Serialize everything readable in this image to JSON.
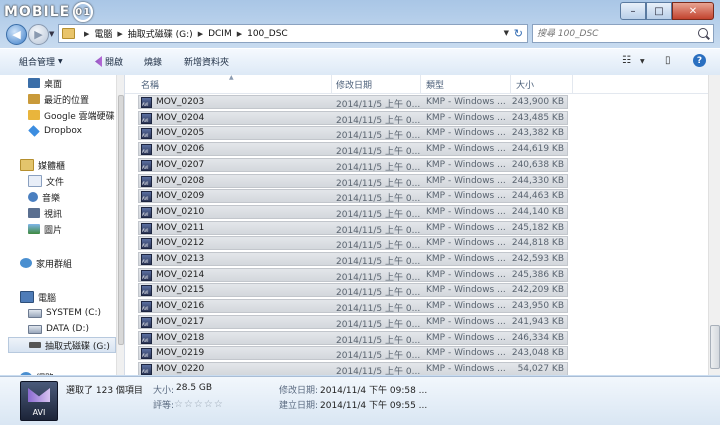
{
  "watermark": {
    "text": "MOBILE",
    "badge": "01"
  },
  "window_controls": {
    "minimize": "–",
    "maximize": "□",
    "close": "✕"
  },
  "nav_buttons": {
    "back": "◀",
    "forward": "▶",
    "dropdown": "▼"
  },
  "address": {
    "crumbs": [
      "電腦",
      "抽取式磁碟 (G:)",
      "DCIM",
      "100_DSC"
    ],
    "separator": "▶",
    "dropdown": "▼",
    "refresh": "↻"
  },
  "search": {
    "placeholder": "搜尋 100_DSC"
  },
  "toolbar": {
    "organize": "組合管理",
    "organize_arrow": "▼",
    "open": "開啟",
    "burn": "燒錄",
    "new_folder": "新增資料夾",
    "view_icon": "☷",
    "view_arrow": "▼",
    "pane_icon": "▯",
    "help": "?"
  },
  "sidebar": {
    "items": [
      {
        "label": "桌面",
        "icon": "desktop-icon"
      },
      {
        "label": "最近的位置",
        "icon": "recent-places-icon"
      },
      {
        "label": "Google 雲端硬碟",
        "icon": "google-drive-icon"
      },
      {
        "label": "Dropbox",
        "icon": "dropbox-icon"
      },
      {
        "label": "媒體櫃",
        "icon": "library-icon"
      },
      {
        "label": "文件",
        "icon": "documents-icon"
      },
      {
        "label": "音樂",
        "icon": "music-icon"
      },
      {
        "label": "視訊",
        "icon": "video-icon"
      },
      {
        "label": "圖片",
        "icon": "pictures-icon"
      },
      {
        "label": "家用群組",
        "icon": "homegroup-icon"
      },
      {
        "label": "電腦",
        "icon": "computer-icon"
      },
      {
        "label": "SYSTEM (C:)",
        "icon": "drive-icon"
      },
      {
        "label": "DATA (D:)",
        "icon": "drive-icon"
      },
      {
        "label": "抽取式磁碟 (G:)",
        "icon": "usb-drive-icon"
      },
      {
        "label": "網路",
        "icon": "network-icon"
      }
    ]
  },
  "columns": {
    "name": "名稱",
    "modified": "修改日期",
    "type": "類型",
    "size": "大小",
    "sort_arrow": "▲"
  },
  "files": [
    {
      "name": "MOV_0203",
      "modified": "2014/11/5 上午 0...",
      "type": "KMP - Windows ...",
      "size": "243,900 KB"
    },
    {
      "name": "MOV_0204",
      "modified": "2014/11/5 上午 0...",
      "type": "KMP - Windows ...",
      "size": "243,485 KB"
    },
    {
      "name": "MOV_0205",
      "modified": "2014/11/5 上午 0...",
      "type": "KMP - Windows ...",
      "size": "243,382 KB"
    },
    {
      "name": "MOV_0206",
      "modified": "2014/11/5 上午 0...",
      "type": "KMP - Windows ...",
      "size": "244,619 KB"
    },
    {
      "name": "MOV_0207",
      "modified": "2014/11/5 上午 0...",
      "type": "KMP - Windows ...",
      "size": "240,638 KB"
    },
    {
      "name": "MOV_0208",
      "modified": "2014/11/5 上午 0...",
      "type": "KMP - Windows ...",
      "size": "244,330 KB"
    },
    {
      "name": "MOV_0209",
      "modified": "2014/11/5 上午 0...",
      "type": "KMP - Windows ...",
      "size": "244,463 KB"
    },
    {
      "name": "MOV_0210",
      "modified": "2014/11/5 上午 0...",
      "type": "KMP - Windows ...",
      "size": "244,140 KB"
    },
    {
      "name": "MOV_0211",
      "modified": "2014/11/5 上午 0...",
      "type": "KMP - Windows ...",
      "size": "245,182 KB"
    },
    {
      "name": "MOV_0212",
      "modified": "2014/11/5 上午 0...",
      "type": "KMP - Windows ...",
      "size": "244,818 KB"
    },
    {
      "name": "MOV_0213",
      "modified": "2014/11/5 上午 0...",
      "type": "KMP - Windows ...",
      "size": "242,593 KB"
    },
    {
      "name": "MOV_0214",
      "modified": "2014/11/5 上午 0...",
      "type": "KMP - Windows ...",
      "size": "245,386 KB"
    },
    {
      "name": "MOV_0215",
      "modified": "2014/11/5 上午 0...",
      "type": "KMP - Windows ...",
      "size": "242,209 KB"
    },
    {
      "name": "MOV_0216",
      "modified": "2014/11/5 上午 0...",
      "type": "KMP - Windows ...",
      "size": "243,950 KB"
    },
    {
      "name": "MOV_0217",
      "modified": "2014/11/5 上午 0...",
      "type": "KMP - Windows ...",
      "size": "241,943 KB"
    },
    {
      "name": "MOV_0218",
      "modified": "2014/11/5 上午 0...",
      "type": "KMP - Windows ...",
      "size": "246,334 KB"
    },
    {
      "name": "MOV_0219",
      "modified": "2014/11/5 上午 0...",
      "type": "KMP - Windows ...",
      "size": "243,048 KB"
    },
    {
      "name": "MOV_0220",
      "modified": "2014/11/5 上午 0...",
      "type": "KMP - Windows ...",
      "size": "54,027 KB"
    }
  ],
  "details": {
    "icon_label": "AVI",
    "selection": "選取了 123 個項目",
    "size_label": "大小:",
    "size_value": "28.5 GB",
    "rating_label": "評等:",
    "stars": "☆☆☆☆☆",
    "modified_label": "修改日期:",
    "modified_value": "2014/11/4 下午 09:58 ...",
    "created_label": "建立日期:",
    "created_value": "2014/11/4 下午 09:55 ..."
  }
}
